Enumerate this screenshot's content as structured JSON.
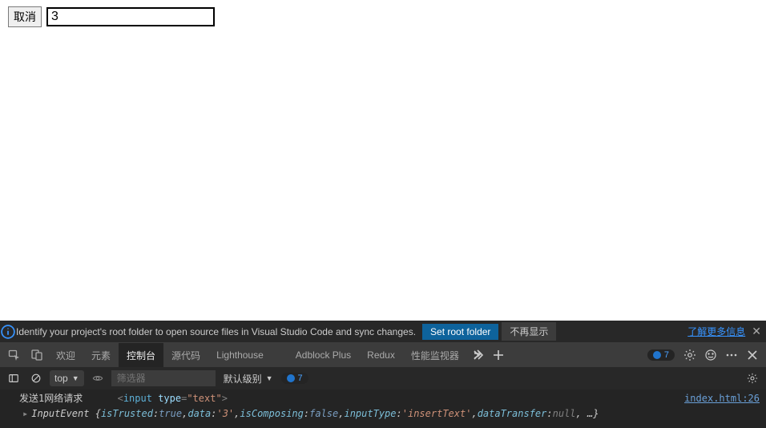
{
  "page": {
    "cancel_label": "取消",
    "input_value": "3"
  },
  "infobar": {
    "message": "Identify your project's root folder to open source files in Visual Studio Code and sync changes.",
    "primary_btn": "Set root folder",
    "secondary_btn": "不再显示",
    "learn_more": "了解更多信息"
  },
  "tabs": {
    "items": [
      "欢迎",
      "元素",
      "控制台",
      "源代码",
      "Lighthouse",
      "Adblock Plus",
      "Redux",
      "性能监视器"
    ],
    "active_index": 2,
    "issue_count": "7"
  },
  "toolbar": {
    "context": "top",
    "filter_placeholder": "筛选器",
    "level_label": "默认级别",
    "issue_count": "7"
  },
  "console": {
    "line1_prefix": "发送1网络请求",
    "line1_tag": "input",
    "line1_attr": "type",
    "line1_val": "\"text\"",
    "source_link": "index.html:26",
    "line2_class": "InputEvent",
    "line2_props": {
      "isTrusted": "true",
      "data": "'3'",
      "isComposing": "false",
      "inputType": "'insertText'",
      "dataTransfer": "null"
    }
  }
}
